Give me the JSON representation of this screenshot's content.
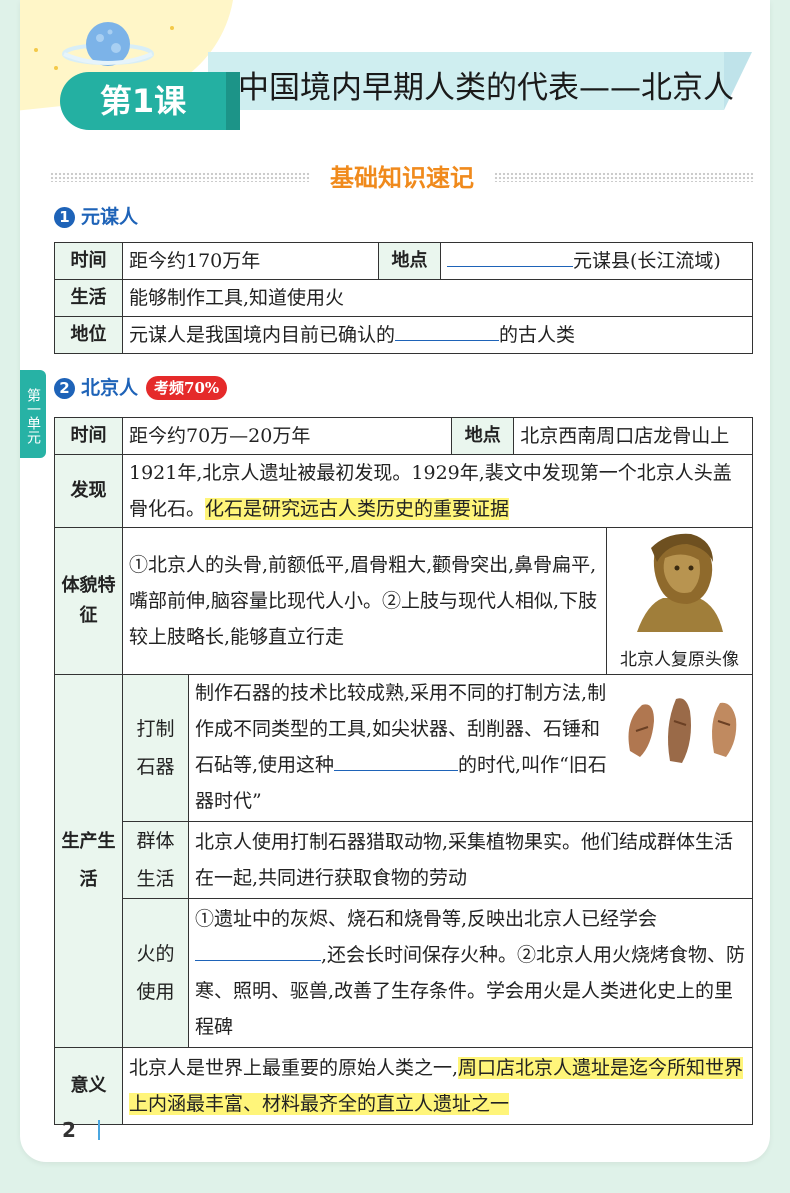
{
  "lesson": {
    "badge": "第1课",
    "title": "中国境内早期人类的代表——北京人"
  },
  "section_title": "基础知识速记",
  "side_tab": "第一单元",
  "yuanmou": {
    "number": "1",
    "heading": "元谋人",
    "time_label": "时间",
    "time_value": "距今约170万年",
    "place_label": "地点",
    "place_value": "元谋县(长江流域)",
    "life_label": "生活",
    "life_value": "能够制作工具,知道使用火",
    "status_label": "地位",
    "status_before": "元谋人是我国境内目前已确认的",
    "status_after": "的古人类"
  },
  "peking": {
    "number": "2",
    "heading": "北京人",
    "freq": "考频70%",
    "time_label": "时间",
    "time_value": "距今约70万—20万年",
    "place_label": "地点",
    "place_value": "北京西南周口店龙骨山上",
    "discovery_label": "发现",
    "discovery_text": "1921年,北京人遗址被最初发现。1929年,裴文中发现第一个北京人头盖骨化石。",
    "discovery_highlight": "化石是研究远古人类历史的重要证据",
    "features_label": "体貌特征",
    "features_text": "①北京人的头骨,前额低平,眉骨粗大,颧骨突出,鼻骨扁平,嘴部前伸,脑容量比现代人小。②上肢与现代人相似,下肢较上肢略长,能够直立行走",
    "image_caption": "北京人复原头像",
    "production_label": "生产生活",
    "tools_label": "打制石器",
    "tools_before": "制作石器的技术比较成熟,采用不同的打制方法,制作成不同类型的工具,如尖状器、刮削器、石锤和石砧等,使用这种",
    "tools_after": "的时代,叫作“旧石器时代”",
    "group_label": "群体生活",
    "group_text": "北京人使用打制石器猎取动物,采集植物果实。他们结成群体生活在一起,共同进行获取食物的劳动",
    "fire_label": "火的使用",
    "fire_before": "①遗址中的灰烬、烧石和烧骨等,反映出北京人已经学会",
    "fire_after": ",还会长时间保存火种。②北京人用火烧烤食物、防寒、照明、驱兽,改善了生存条件。学会用火是人类进化史上的里程碑",
    "significance_label": "意义",
    "significance_text": "北京人是世界上最重要的原始人类之一,",
    "significance_highlight": "周口店北京人遗址是迄今所知世界上内涵最丰富、材料最齐全的直立人遗址之一"
  },
  "page_number": "2"
}
